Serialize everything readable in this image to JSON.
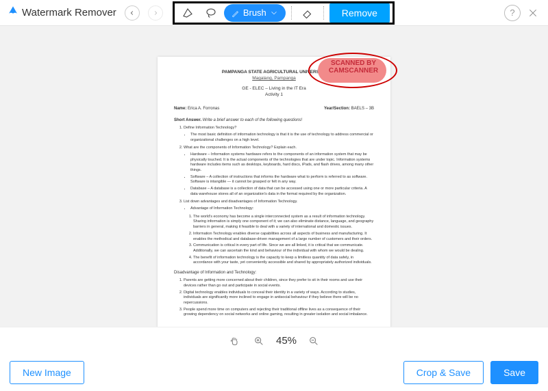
{
  "app": {
    "title": "Watermark Remover"
  },
  "toolbar": {
    "brush_label": "Brush",
    "remove_label": "Remove"
  },
  "zoom": {
    "value": "45%"
  },
  "buttons": {
    "new_image": "New Image",
    "crop_save": "Crop & Save",
    "save": "Save"
  },
  "watermark": {
    "line1": "SCANNED BY",
    "line2": "CAMSCANNER"
  },
  "doc": {
    "univ": "PAMPANGA STATE AGRICULTURAL UNIVERSITY",
    "loc": "Magalang, Pampanga",
    "course1": "GE - ELEC – Living in the IT Era",
    "course2": "Activity 1",
    "name_lbl": "Name:",
    "name_val": "Erica A. Forronas",
    "sec_lbl": "Year/Section:",
    "sec_val": "BAELS – 3B",
    "sa_lbl": "Short Answer.",
    "sa_txt": "Write a brief answer to each of the following questions!",
    "q1": "Define Information Technology?",
    "q1b1": "The most basic definition of information technology is that it is the use of technology to address commercial or organizational challenges on a high level.",
    "q2": "What are the components of Information Technology? Explain each.",
    "q2b1": "Hardware – Information systems hardware refers to the components of an information system that may be physically touched. It is the actual components of the technologies that are under topic. Information systems hardware includes items such as desktops, keyboards, hard discs, iPads, and flash drives, among many other things.",
    "q2b2": "Software – A collection of instructions that informs the hardware what to perform is referred to as software. Software is intangible — it cannot be grasped or felt in any way.",
    "q2b3": "Database – A database is a collection of data that can be accessed using one or more particular criteria. A data warehouse stores all of an organization's data in the format required by the organization.",
    "q3": "List down advantages and disadvantages of Information Technology.",
    "q3h": "Advantage of Information Technology:",
    "q3a1": "The world's economy has become a single interconnected system as a result of information technology. Sharing information is simply one component of it; we can also eliminate distance, language, and geography barriers in general, making it feasible to deal with a variety of international and domestic issues.",
    "q3a2": "Information Technology enables diverse capabilities across all aspects of business and manufacturing. It enables the methodical and database-driven management of a large number of customers and their orders.",
    "q3a3": "Communication is critical in every part of life. Since we are all linked, it is critical that we communicate. Additionally, we can ascertain the kind and behaviour of the individual with whom we would be dealing.",
    "q3a4": "The benefit of information technology is the capacity to keep a limitless quantity of data safely, in accordance with your taste, yet conveniently accessible and shared by appropriately authorized individuals.",
    "q3dh": "Disadvantage of Information and Technology:",
    "q3d1": "Parents are getting more concerned about their children, since they prefer to sit in their rooms and use their devices rather than go out and participate in social events.",
    "q3d2": "Digital technology enables individuals to conceal their identity in a variety of ways. According to studies, individuals are significantly more inclined to engage in antisocial behaviour if they believe there will be no repercussions.",
    "q3d3": "People spend more time on computers and rejecting their traditional offline lives as a consequence of their growing dependency on social networks and online gaming, resulting in greater isolation and social imbalance."
  }
}
